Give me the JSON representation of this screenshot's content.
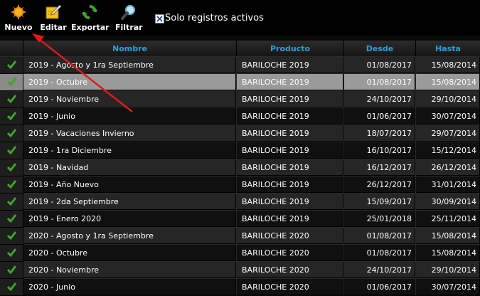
{
  "toolbar": {
    "buttons": [
      {
        "label": "Nuevo",
        "icon": "sun-icon"
      },
      {
        "label": "Editar",
        "icon": "edit-icon"
      },
      {
        "label": "Exportar",
        "icon": "refresh-icon"
      },
      {
        "label": "Filtrar",
        "icon": "magnifier-icon"
      }
    ],
    "filter_checkbox": {
      "label": "Solo registros activos",
      "checked": true
    }
  },
  "table": {
    "columns": [
      "",
      "Nombre",
      "Producto",
      "Desde",
      "Hasta"
    ],
    "selected_row": 1,
    "rows": [
      {
        "nombre": "2019 - Agosto y 1ra Septiembre",
        "producto": "BARILOCHE 2019",
        "desde": "01/08/2017",
        "hasta": "15/08/2014"
      },
      {
        "nombre": "2019 - Octubre",
        "producto": "BARILOCHE 2019",
        "desde": "01/08/2017",
        "hasta": "15/08/2014"
      },
      {
        "nombre": "2019 - Noviembre",
        "producto": "BARILOCHE 2019",
        "desde": "24/10/2017",
        "hasta": "29/10/2014"
      },
      {
        "nombre": "2019 - Junio",
        "producto": "BARILOCHE 2019",
        "desde": "01/06/2017",
        "hasta": "30/07/2014"
      },
      {
        "nombre": "2019 - Vacaciones Invierno",
        "producto": "BARILOCHE 2019",
        "desde": "18/07/2017",
        "hasta": "29/07/2014"
      },
      {
        "nombre": "2019 - 1ra Diciembre",
        "producto": "BARILOCHE 2019",
        "desde": "16/10/2017",
        "hasta": "15/12/2014"
      },
      {
        "nombre": "2019 - Navidad",
        "producto": "BARILOCHE 2019",
        "desde": "16/12/2017",
        "hasta": "26/12/2014"
      },
      {
        "nombre": "2019 - Año Nuevo",
        "producto": "BARILOCHE 2019",
        "desde": "26/12/2017",
        "hasta": "31/01/2014"
      },
      {
        "nombre": "2019 - 2da Septiembre",
        "producto": "BARILOCHE 2019",
        "desde": "15/09/2017",
        "hasta": "30/09/2014"
      },
      {
        "nombre": "2019 - Enero 2020",
        "producto": "BARILOCHE 2019",
        "desde": "25/01/2018",
        "hasta": "25/11/2014"
      },
      {
        "nombre": "2020 - Agosto y 1ra Septiembre",
        "producto": "BARILOCHE 2020",
        "desde": "01/08/2017",
        "hasta": "15/08/2014"
      },
      {
        "nombre": "2020 - Octubre",
        "producto": "BARILOCHE 2020",
        "desde": "01/08/2017",
        "hasta": "15/08/2014"
      },
      {
        "nombre": "2020 - Noviembre",
        "producto": "BARILOCHE 2020",
        "desde": "24/10/2017",
        "hasta": "29/10/2014"
      },
      {
        "nombre": "2020 - Junio",
        "producto": "BARILOCHE 2020",
        "desde": "01/06/2017",
        "hasta": "30/07/2014"
      }
    ]
  },
  "colors": {
    "header_text": "#2e9fd8",
    "check_green": "#3fa52a",
    "annotation_arrow": "#e0191b"
  }
}
